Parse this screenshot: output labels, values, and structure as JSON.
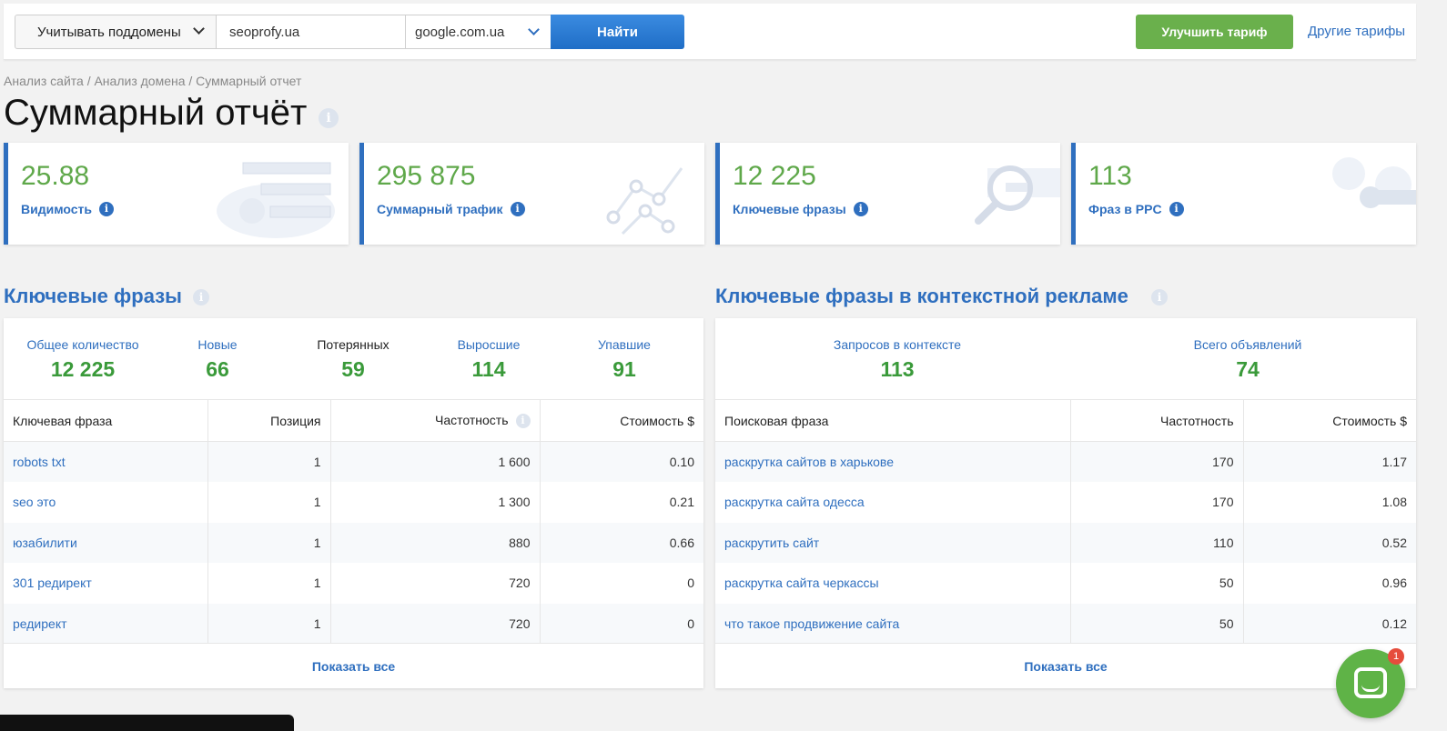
{
  "search": {
    "subdomains_label": "Учитывать поддомены",
    "domain_value": "seoprofy.ua",
    "engine_value": "google.com.ua",
    "find_label": "Найти"
  },
  "header": {
    "upgrade_label": "Улучшить тариф",
    "other_plans_label": "Другие тарифы"
  },
  "breadcrumb": "Анализ сайта / Анализ домена / Суммарный отчет",
  "page_title": "Суммарный отчёт",
  "cards": [
    {
      "value": "25.88",
      "label": "Видимость"
    },
    {
      "value": "295 875",
      "label": "Суммарный трафик"
    },
    {
      "value": "12 225",
      "label": "Ключевые фразы"
    },
    {
      "value": "113",
      "label": "Фраз в PPC"
    }
  ],
  "keywords": {
    "title": "Ключевые фразы",
    "stats": [
      {
        "label": "Общее количество",
        "value": "12 225"
      },
      {
        "label": "Новые",
        "value": "66"
      },
      {
        "label": "Потерянных",
        "value": "59"
      },
      {
        "label": "Выросшие",
        "value": "114"
      },
      {
        "label": "Упавшие",
        "value": "91"
      }
    ],
    "columns": [
      "Ключевая фраза",
      "Позиция",
      "Частотность",
      "Стоимость $"
    ],
    "rows": [
      {
        "phrase": "robots txt",
        "position": "1",
        "frequency": "1 600",
        "cost": "0.10"
      },
      {
        "phrase": "seo это",
        "position": "1",
        "frequency": "1 300",
        "cost": "0.21"
      },
      {
        "phrase": "юзабилити",
        "position": "1",
        "frequency": "880",
        "cost": "0.66"
      },
      {
        "phrase": "301 редирект",
        "position": "1",
        "frequency": "720",
        "cost": "0"
      },
      {
        "phrase": "редирект",
        "position": "1",
        "frequency": "720",
        "cost": "0"
      }
    ],
    "show_all": "Показать все"
  },
  "ppc": {
    "title": "Ключевые фразы в контекстной рекламе",
    "stats": [
      {
        "label": "Запросов в контексте",
        "value": "113"
      },
      {
        "label": "Всего объявлений",
        "value": "74"
      }
    ],
    "columns": [
      "Поисковая фраза",
      "Частотность",
      "Стоимость $"
    ],
    "rows": [
      {
        "phrase": "раскрутка сайтов в харькове",
        "frequency": "170",
        "cost": "1.17"
      },
      {
        "phrase": "раскрутка сайта одесса",
        "frequency": "170",
        "cost": "1.08"
      },
      {
        "phrase": "раскрутить сайт",
        "frequency": "110",
        "cost": "0.52"
      },
      {
        "phrase": "раскрутка сайта черкассы",
        "frequency": "50",
        "cost": "0.96"
      },
      {
        "phrase": "что такое продвижение сайта",
        "frequency": "50",
        "cost": "0.12"
      }
    ],
    "show_all": "Показать все"
  },
  "chat": {
    "badge": "1"
  },
  "info_glyph": "i",
  "colors": {
    "accent": "#2f6fbf",
    "value_green": "#5fa84a",
    "upgrade_green": "#6ab04c"
  }
}
